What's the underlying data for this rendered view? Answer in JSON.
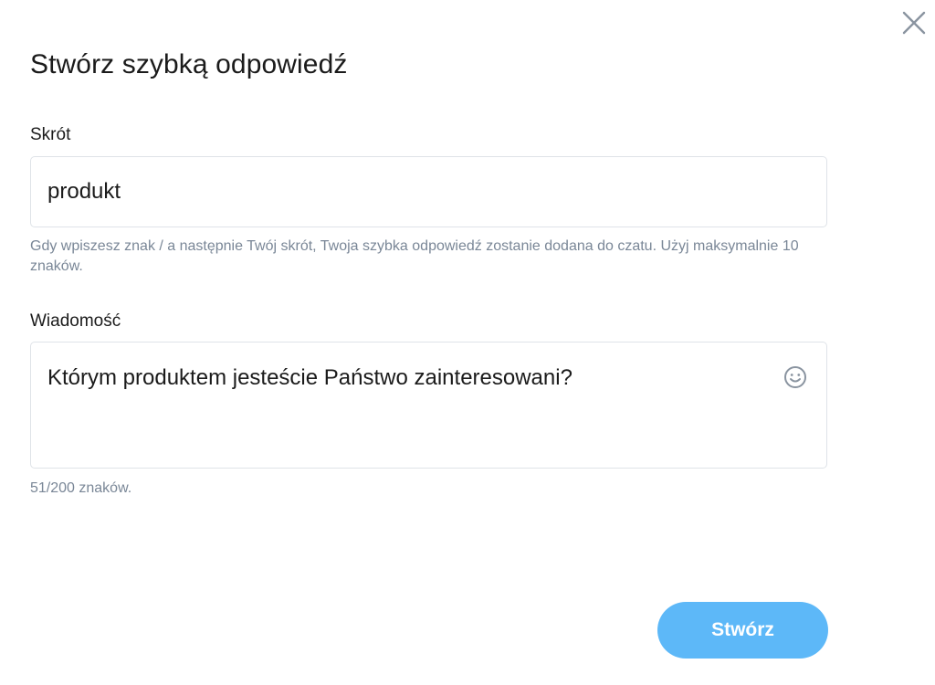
{
  "dialog": {
    "title": "Stwórz szybką odpowiedź",
    "close_icon": "close-icon"
  },
  "shortcut": {
    "label": "Skrót",
    "value": "produkt",
    "help": "Gdy wpiszesz znak / a następnie Twój skrót, Twoja szybka odpowiedź zostanie dodana do czatu. Użyj maksymalnie 10 znaków."
  },
  "message": {
    "label": "Wiadomość",
    "value": "Którym produktem jesteście Państwo zainteresowani?",
    "emoji_icon": "smiley-icon",
    "counter": "51/200 znaków."
  },
  "actions": {
    "create_label": "Stwórz"
  },
  "colors": {
    "primary_button": "#5db8f8",
    "help_text": "#7a8797",
    "border": "#dfe3e8"
  }
}
